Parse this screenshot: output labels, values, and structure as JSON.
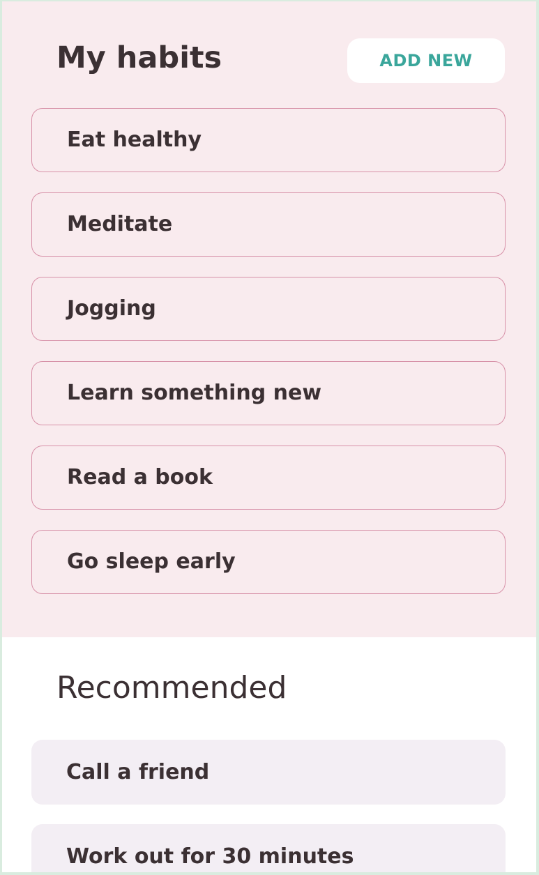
{
  "my_habits": {
    "title": "My habits",
    "add_button_label": "ADD NEW",
    "items": [
      {
        "label": "Eat healthy"
      },
      {
        "label": "Meditate"
      },
      {
        "label": "Jogging"
      },
      {
        "label": "Learn something new"
      },
      {
        "label": "Read a book"
      },
      {
        "label": "Go sleep early"
      }
    ]
  },
  "recommended": {
    "title": "Recommended",
    "items": [
      {
        "label": "Call a friend"
      },
      {
        "label": "Work out for 30 minutes"
      }
    ]
  },
  "colors": {
    "habits_background": "#f9ebee",
    "habit_border": "#d791a8",
    "accent_text": "#3aa69b",
    "recommended_item_background": "#f3eef4",
    "text": "#3b3033"
  }
}
